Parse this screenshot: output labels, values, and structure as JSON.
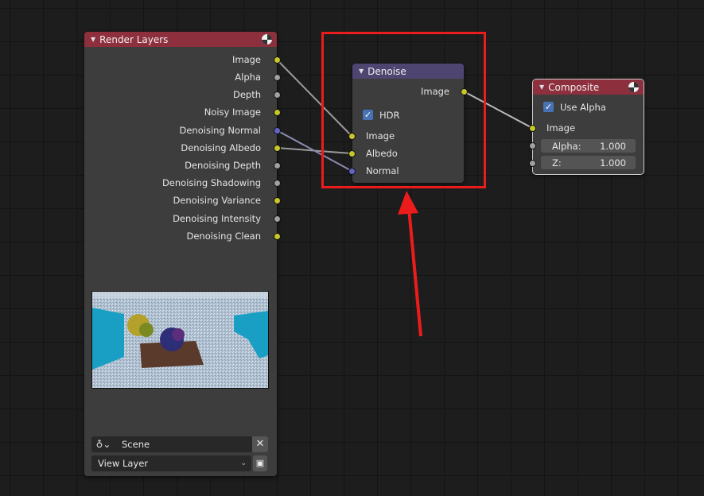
{
  "render_layers": {
    "title": "Render Layers",
    "outputs": [
      {
        "label": "Image",
        "color": "yellow"
      },
      {
        "label": "Alpha",
        "color": "grey"
      },
      {
        "label": "Depth",
        "color": "grey"
      },
      {
        "label": "Noisy Image",
        "color": "yellow"
      },
      {
        "label": "Denoising Normal",
        "color": "purple"
      },
      {
        "label": "Denoising Albedo",
        "color": "yellow"
      },
      {
        "label": "Denoising Depth",
        "color": "grey"
      },
      {
        "label": "Denoising Shadowing",
        "color": "grey"
      },
      {
        "label": "Denoising Variance",
        "color": "yellow"
      },
      {
        "label": "Denoising Intensity",
        "color": "grey"
      },
      {
        "label": "Denoising Clean",
        "color": "yellow"
      }
    ],
    "scene_value": "Scene",
    "view_layer_value": "View Layer"
  },
  "denoise": {
    "title": "Denoise",
    "output_label": "Image",
    "hdr_label": "HDR",
    "hdr_checked": true,
    "inputs": [
      "Image",
      "Albedo",
      "Normal"
    ]
  },
  "composite": {
    "title": "Composite",
    "use_alpha_label": "Use Alpha",
    "use_alpha_checked": true,
    "input_label": "Image",
    "alpha_label": "Alpha:",
    "alpha_value": "1.000",
    "z_label": "Z:",
    "z_value": "1.000"
  },
  "colors": {
    "render_header": "#8e2f3d",
    "denoise_header": "#4e4571",
    "composite_header": "#8e2f3d",
    "annotation": "#ec1c1c"
  }
}
